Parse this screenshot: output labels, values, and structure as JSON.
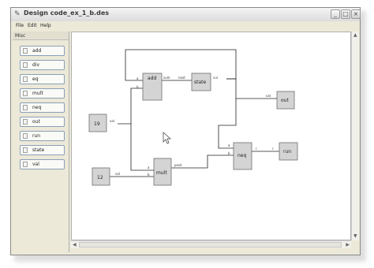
{
  "window": {
    "title": "Design code_ex_1_b.des",
    "app_icon": "design-app-icon",
    "controls": {
      "minimize": "_",
      "maximize": "□",
      "close": "×"
    }
  },
  "menu": {
    "items": [
      "File",
      "Edit",
      "Help"
    ]
  },
  "palette": {
    "header": "Misc",
    "buttons": [
      "add",
      "div",
      "eq",
      "mult",
      "neq",
      "out",
      "run",
      "state",
      "val"
    ]
  },
  "diagram": {
    "blocks": {
      "add": "add",
      "state": "state",
      "out": "out",
      "const19": "19",
      "const12": "12",
      "mult": "mult",
      "neq": "neq",
      "run": "run"
    },
    "ports": {
      "add_a": "a",
      "add_b": "b",
      "add_sum": "sum",
      "state_next": "next",
      "state_cur": "cur",
      "out_val": "val",
      "c19_val": "val",
      "c12_val": "val",
      "mult_a": "a",
      "mult_b": "b",
      "mult_prod": "prod",
      "neq_a": "a",
      "neq_b": "b",
      "neq_r": "r",
      "run_r": "r"
    }
  }
}
